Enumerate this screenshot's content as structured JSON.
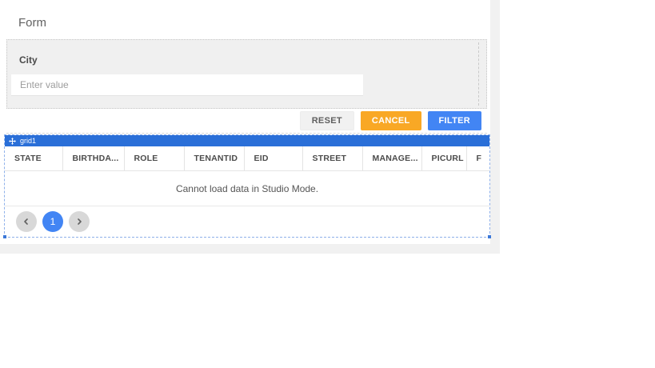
{
  "canvas": {
    "form": {
      "title": "Form",
      "field": {
        "label": "City",
        "placeholder": "Enter value",
        "value": ""
      },
      "actions": {
        "reset": "RESET",
        "cancel": "CANCEL",
        "filter": "FILTER"
      }
    },
    "grid": {
      "widget_name": "grid1",
      "columns": [
        "STATE",
        "BIRTHDA...",
        "ROLE",
        "TENANTID",
        "EID",
        "STREET",
        "MANAGE...",
        "PICURL",
        "F"
      ],
      "empty_message": "Cannot load data in Studio Mode.",
      "pagination": {
        "current_page": "1"
      }
    }
  },
  "icons": {
    "grid_handle": "move-icon",
    "page_prev": "chevron-left-icon",
    "page_next": "chevron-right-icon"
  },
  "colors": {
    "accent_blue": "#4285f4",
    "titlebar_blue": "#2a6fd8",
    "cancel_orange": "#f9a825",
    "selection_dash_blue": "#8fb1ea",
    "panel_gray": "#f0f0f0",
    "track_gray": "#f1f1f1"
  }
}
